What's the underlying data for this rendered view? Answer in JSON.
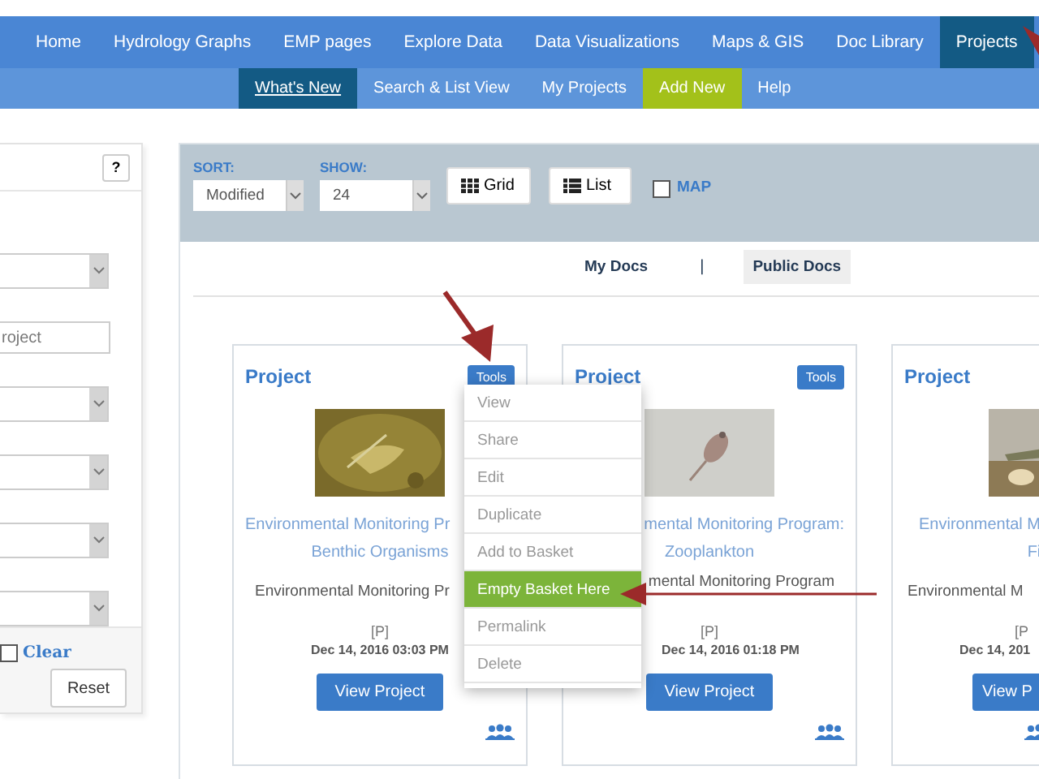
{
  "nav": [
    {
      "label": "Home",
      "selected": false
    },
    {
      "label": "Hydrology Graphs",
      "selected": false
    },
    {
      "label": "EMP pages",
      "selected": false
    },
    {
      "label": "Explore Data",
      "selected": false
    },
    {
      "label": "Data Visualizations",
      "selected": false
    },
    {
      "label": "Maps & GIS",
      "selected": false
    },
    {
      "label": "Doc Library",
      "selected": false
    },
    {
      "label": "Projects",
      "selected": true
    }
  ],
  "subnav": [
    {
      "label": "What's New",
      "selected": true,
      "kind": "tab"
    },
    {
      "label": "Search & List View",
      "selected": false,
      "kind": "tab"
    },
    {
      "label": "My Projects",
      "selected": false,
      "kind": "tab"
    },
    {
      "label": "Add New",
      "selected": false,
      "kind": "accent"
    },
    {
      "label": "Help",
      "selected": false,
      "kind": "tab"
    }
  ],
  "filters": {
    "help": "?",
    "fields": [
      {
        "kind": "select"
      },
      {
        "kind": "input",
        "placeholder": "roject"
      },
      {
        "kind": "select"
      },
      {
        "kind": "select"
      },
      {
        "kind": "select"
      },
      {
        "kind": "select"
      }
    ],
    "clear": {
      "label": "Clear",
      "checked": false
    },
    "reset": "Reset"
  },
  "toolbar": {
    "sort": {
      "label": "SORT:",
      "value": "Modified"
    },
    "show": {
      "label": "SHOW:",
      "value": "24"
    },
    "grid": "Grid",
    "list": "List",
    "map": {
      "label": "MAP",
      "checked": false
    }
  },
  "doc_tabs": [
    {
      "label": "My Docs",
      "selected": false
    },
    {
      "label": "Public Docs",
      "selected": true
    }
  ],
  "doc_tab_separator": "|",
  "cards": [
    {
      "heading": "Project",
      "tools": "Tools",
      "title_lines": [
        "Environmental Monitoring Pr",
        "Benthic Organisms"
      ],
      "program": "Environmental Monitoring Pr",
      "tag": "[P]",
      "date": "Dec 14, 2016 03:03 PM",
      "button": "View Project"
    },
    {
      "heading": "Project",
      "tools": "Tools",
      "title_lines": [
        "mental Monitoring Program:",
        "Zooplankton"
      ],
      "program": "mental Monitoring Program",
      "tag": "[P]",
      "date": "Dec 14, 2016 01:18 PM",
      "button": "View Project"
    },
    {
      "heading": "Project",
      "title_lines": [
        "Environmental M",
        "Fi"
      ],
      "program": "Environmental M",
      "tag": "[P",
      "date": "Dec 14, 201",
      "button": "View P"
    }
  ],
  "tools_menu": [
    {
      "label": "View",
      "selected": false
    },
    {
      "label": "Share",
      "selected": false
    },
    {
      "label": "Edit",
      "selected": false
    },
    {
      "label": "Duplicate",
      "selected": false
    },
    {
      "label": "Add to Basket",
      "selected": false
    },
    {
      "label": "Empty Basket Here",
      "selected": true
    },
    {
      "label": "Permalink",
      "selected": false
    },
    {
      "label": "Delete",
      "selected": false
    }
  ]
}
